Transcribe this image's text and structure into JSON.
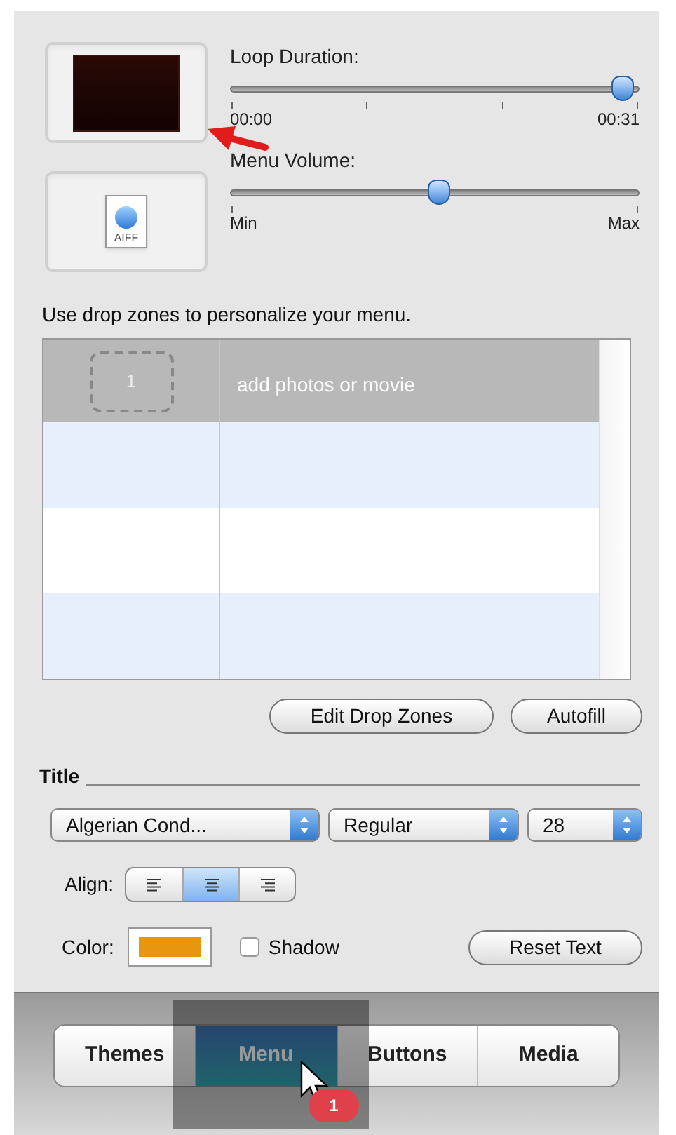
{
  "media": [
    {
      "kind": "movie"
    },
    {
      "kind": "audio",
      "label": "AIFF"
    }
  ],
  "loop_duration": {
    "label": "Loop Duration:",
    "level": 0.96,
    "min": "00:00",
    "max": "00:31"
  },
  "menu_volume": {
    "label": "Menu Volume:",
    "level": 0.51,
    "min": "Min",
    "max": "Max"
  },
  "drop_zones": {
    "hint": "Use drop zones to personalize your menu.",
    "rows": [
      {
        "number": "1",
        "text": "add photos or movie"
      }
    ]
  },
  "buttons": [
    "Edit Drop Zones",
    "Autofill"
  ],
  "title_section": {
    "heading": "Title",
    "font": "Algerian Cond...",
    "style": "Regular",
    "size": "28",
    "align_label": "Align:",
    "align": [
      {
        "kind": "left",
        "selected": false
      },
      {
        "kind": "center",
        "selected": true
      },
      {
        "kind": "right",
        "selected": false
      }
    ],
    "color_label": "Color:",
    "color": "#e8960f",
    "shadow": {
      "label": "Shadow",
      "checked": false
    },
    "reset": "Reset Text"
  },
  "tabs": [
    {
      "label": "Themes",
      "selected": false
    },
    {
      "label": "Menu",
      "selected": true
    },
    {
      "label": "Buttons",
      "selected": false
    },
    {
      "label": "Media",
      "selected": false
    }
  ],
  "callout": {
    "badge": "1"
  }
}
